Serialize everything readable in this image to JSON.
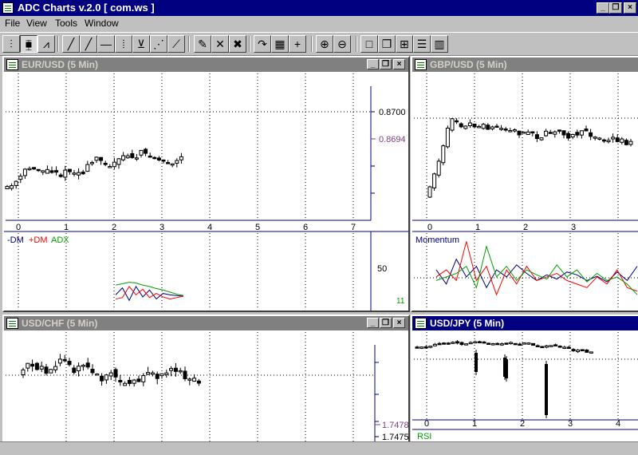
{
  "app": {
    "title": "ADC Charts v.2.0 [ com.ws ]"
  },
  "window_controls": {
    "minimize": "_",
    "restore": "❐",
    "close": "×"
  },
  "menu": [
    "File",
    "View",
    "Tools",
    "Window"
  ],
  "toolbar": [
    {
      "name": "bar-chart-button",
      "glyph": "⫶"
    },
    {
      "name": "candlestick-button",
      "glyph": "⧯",
      "pressed": true
    },
    {
      "name": "line-chart-button",
      "glyph": "⩘"
    },
    {
      "name": "trendline-button",
      "glyph": "╱"
    },
    {
      "name": "yellow-line-button",
      "glyph": "╱"
    },
    {
      "name": "horizontal-line-button",
      "glyph": "—"
    },
    {
      "name": "vertical-lines-button",
      "glyph": "⦙"
    },
    {
      "name": "fibonacci-fan-button",
      "glyph": "⊻"
    },
    {
      "name": "gann-fan-button",
      "glyph": "⋰"
    },
    {
      "name": "speed-lines-button",
      "glyph": "⟋"
    },
    {
      "name": "pencil-button",
      "glyph": "✎"
    },
    {
      "name": "delete-button",
      "glyph": "✕"
    },
    {
      "name": "delete-all-button",
      "glyph": "✖"
    },
    {
      "name": "refresh-button",
      "glyph": "↷"
    },
    {
      "name": "grid-button",
      "glyph": "▦"
    },
    {
      "name": "crosshair-button",
      "glyph": "+"
    },
    {
      "name": "zoom-in-button",
      "glyph": "⊕"
    },
    {
      "name": "zoom-out-button",
      "glyph": "⊖"
    },
    {
      "name": "single-window-button",
      "glyph": "□"
    },
    {
      "name": "cascade-button",
      "glyph": "❐"
    },
    {
      "name": "tile-button",
      "glyph": "⊞"
    },
    {
      "name": "tile-horizontal-button",
      "glyph": "☰"
    },
    {
      "name": "tile-vertical-button",
      "glyph": "▥"
    }
  ],
  "colors": {
    "up": "#ffffff",
    "down": "#000000",
    "minus_dm": "#000080",
    "plus_dm": "#ff0000",
    "adx": "#00a000",
    "axis": "#000080",
    "last_price": "#804080"
  },
  "windows": {
    "eurusd": {
      "title": "EUR/USD (5 Min)",
      "active": false
    },
    "gbpusd": {
      "title": "GBP/USD (5 Min)",
      "active": false
    },
    "usdchf": {
      "title": "USD/CHF (5 Min)",
      "active": false
    },
    "usdjpy": {
      "title": "USD/JPY (5 Min)",
      "active": true
    }
  },
  "chart_data": [
    {
      "id": "eurusd",
      "type": "candlestick",
      "x_ticks": [
        "0",
        "1",
        "2",
        "3",
        "4",
        "5",
        "6",
        "7"
      ],
      "price_labels": [
        {
          "value": "0.8700",
          "kind": "tick"
        },
        {
          "value": "0.8694",
          "kind": "last"
        }
      ],
      "indicator": {
        "type": "line",
        "legend": [
          "-DM",
          "+DM",
          "ADX"
        ],
        "tick_labels": [
          "50",
          "11"
        ],
        "series": [
          {
            "name": "-DM",
            "values": [
              18,
              28,
              10,
              30,
              15,
              25,
              12,
              20,
              18,
              17,
              16
            ]
          },
          {
            "name": "+DM",
            "values": [
              12,
              14,
              30,
              18,
              26,
              14,
              20,
              15,
              12,
              14,
              16
            ]
          },
          {
            "name": "ADX",
            "values": [
              32,
              34,
              36,
              35,
              32,
              30,
              27,
              25,
              22,
              19,
              17
            ]
          }
        ]
      }
    },
    {
      "id": "gbpusd",
      "type": "candlestick",
      "x_ticks": [
        "0",
        "1",
        "2",
        "3"
      ],
      "price_labels": [],
      "indicator": {
        "type": "line",
        "legend": [
          "Momentum"
        ],
        "tick_labels": [],
        "series": [
          {
            "name": "series-blue",
            "values": [
              55,
              35,
              70,
              45,
              60,
              30,
              55,
              45,
              62,
              50,
              40,
              48,
              42,
              52,
              48,
              40,
              46,
              38,
              52,
              40,
              60
            ]
          },
          {
            "name": "series-red",
            "values": [
              45,
              55,
              40,
              95,
              40,
              60,
              20,
              55,
              35,
              60,
              40,
              45,
              50,
              40,
              35,
              30,
              45,
              35,
              55,
              30,
              25
            ]
          },
          {
            "name": "series-green",
            "values": [
              40,
              45,
              50,
              60,
              30,
              88,
              45,
              60,
              40,
              55,
              48,
              42,
              62,
              45,
              55,
              38,
              50,
              40,
              45,
              35,
              20
            ]
          }
        ]
      }
    },
    {
      "id": "usdchf",
      "type": "candlestick",
      "x_ticks": [],
      "price_labels": [
        {
          "value": "1.7478",
          "kind": "last"
        },
        {
          "value": "1.7475",
          "kind": "tick"
        }
      ]
    },
    {
      "id": "usdjpy",
      "type": "candlestick",
      "x_ticks": [
        "0",
        "1",
        "2",
        "3",
        "4"
      ],
      "price_labels": [],
      "indicator": {
        "type": "line",
        "legend": [
          "RSI"
        ],
        "tick_labels": [],
        "series": []
      }
    }
  ]
}
